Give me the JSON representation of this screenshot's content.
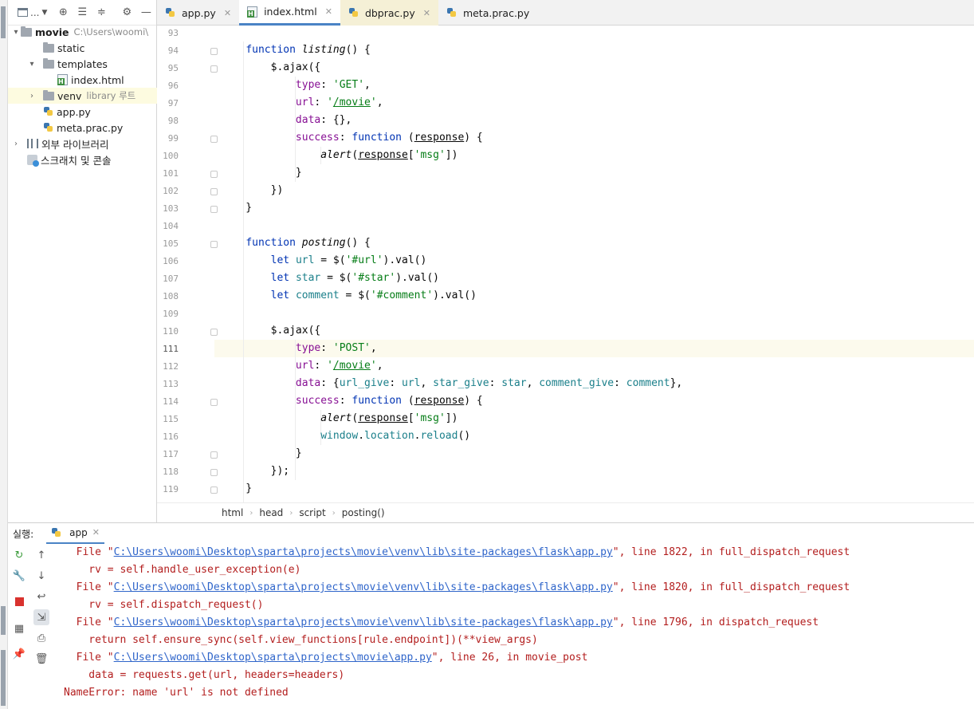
{
  "project_panel": {
    "dropdown_label": "...",
    "tree": [
      {
        "label": "movie",
        "extra": "C:\\Users\\woomi\\"
      },
      {
        "label": "static"
      },
      {
        "label": "templates"
      },
      {
        "label": "index.html"
      },
      {
        "label": "venv",
        "extra": "library 루트"
      },
      {
        "label": "app.py"
      },
      {
        "label": "meta.prac.py"
      },
      {
        "label": "외부 라이브러리"
      },
      {
        "label": "스크래치 및 콘솔"
      }
    ]
  },
  "tabs": [
    {
      "label": "app.py"
    },
    {
      "label": "index.html"
    },
    {
      "label": "dbprac.py"
    },
    {
      "label": "meta.prac.py"
    }
  ],
  "editor": {
    "line_numbers": [
      "93",
      "94",
      "95",
      "96",
      "97",
      "98",
      "99",
      "100",
      "101",
      "102",
      "103",
      "104",
      "105",
      "106",
      "107",
      "108",
      "109",
      "110",
      "111",
      "112",
      "113",
      "114",
      "115",
      "116",
      "117",
      "118",
      "119"
    ],
    "current_line": "111"
  },
  "breadcrumb": [
    "html",
    "head",
    "script",
    "posting()"
  ],
  "run": {
    "label": "실행:",
    "tab_label": "app",
    "console": [
      {
        "prefix": "  File \"",
        "link": "C:\\Users\\woomi\\Desktop\\sparta\\projects\\movie\\venv\\lib\\site-packages\\flask\\app.py",
        "suffix": "\", line 1822, in full_dispatch_request"
      },
      {
        "text": "    rv = self.handle_user_exception(e)"
      },
      {
        "prefix": "  File \"",
        "link": "C:\\Users\\woomi\\Desktop\\sparta\\projects\\movie\\venv\\lib\\site-packages\\flask\\app.py",
        "suffix": "\", line 1820, in full_dispatch_request"
      },
      {
        "text": "    rv = self.dispatch_request()"
      },
      {
        "prefix": "  File \"",
        "link": "C:\\Users\\woomi\\Desktop\\sparta\\projects\\movie\\venv\\lib\\site-packages\\flask\\app.py",
        "suffix": "\", line 1796, in dispatch_request"
      },
      {
        "text": "    return self.ensure_sync(self.view_functions[rule.endpoint])(**view_args)"
      },
      {
        "prefix": "  File \"",
        "link": "C:\\Users\\woomi\\Desktop\\sparta\\projects\\movie\\app.py",
        "suffix": "\", line 26, in movie_post"
      },
      {
        "text": "    data = requests.get(url, headers=headers)"
      },
      {
        "text": "NameError: name 'url' is not defined"
      }
    ]
  },
  "colors": {
    "accent": "#4a83c5",
    "error_text": "#b31e1e",
    "link": "#2f65ca",
    "keyword": "#0033b3",
    "string": "#067d17"
  }
}
